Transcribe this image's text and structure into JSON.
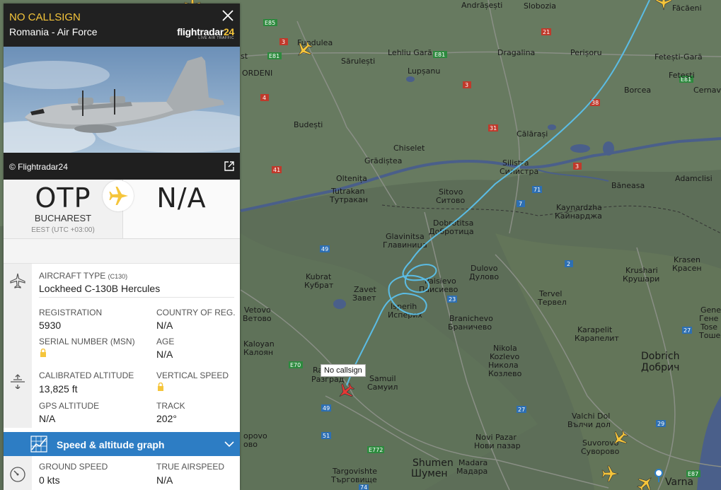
{
  "panel": {
    "callsign": "NO CALLSIGN",
    "operator": "Romania - Air Force",
    "brand_main": "flightradar",
    "brand_num": "24",
    "brand_sub": "LIVE AIR TRAFFIC",
    "photo_credit": "© Flightradar24",
    "origin": {
      "iata": "OTP",
      "city": "BUCHAREST",
      "tz": "EEST (UTC +03:00)"
    },
    "destination": {
      "iata": "N/A"
    },
    "aircraft_type_label": "AIRCRAFT TYPE",
    "aircraft_type_code": "(C130)",
    "aircraft_type_value": "Lockheed C-130B Hercules",
    "registration_label": "REGISTRATION",
    "registration_value": "5930",
    "country_label": "COUNTRY OF REG.",
    "country_value": "N/A",
    "msn_label": "SERIAL NUMBER (MSN)",
    "age_label": "AGE",
    "age_value": "N/A",
    "cal_alt_label": "CALIBRATED ALTITUDE",
    "cal_alt_value": "13,825 ft",
    "vs_label": "VERTICAL SPEED",
    "gps_alt_label": "GPS ALTITUDE",
    "gps_alt_value": "N/A",
    "track_label": "TRACK",
    "track_value": "202°",
    "graph_label": "Speed & altitude graph",
    "ground_speed_label": "GROUND SPEED",
    "ground_speed_value": "0 kts",
    "tas_label": "TRUE AIRSPEED",
    "tas_value": "N/A"
  },
  "map": {
    "tooltip": "No callsign",
    "labels": {
      "andrasesti": "Andrășești",
      "slobozia": "Slobozia",
      "facaeni": "Făcăeni",
      "fundulea": "Fundulea",
      "lehliu": "Lehliu Gară",
      "dragalina": "Dragalina",
      "perisoru": "Perișoru",
      "fetesti_gara": "Fetești-Gară",
      "sarulesti": "Sărulești",
      "lupsanu": "Lupșanu",
      "fetesti": "Fetești",
      "borcea": "Borcea",
      "cernavoda": "Cernavo",
      "budesti": "Budești",
      "calarasi": "Călărași",
      "chiselet": "Chiselet",
      "gradistea": "Grădiștea",
      "silistra": "Silistra",
      "silistra_cy": "Силистра",
      "oltenita": "Oltenița",
      "baneasa": "Băneasa",
      "adamclisi": "Adamclisi",
      "tutrakan": "Tutrakan",
      "tutrakan_cy": "Тутракан",
      "sitovo": "Sitovo",
      "sitovo_cy": "Ситово",
      "kaynardzha": "Kaynardzha",
      "kaynardzha_cy": "Кайнарджа",
      "dobrotitsa": "Dobrotitsa",
      "dobrotitsa_cy": "Добротица",
      "glavinitsa": "Glavinitsa",
      "glavinitsa_cy": "Главиница",
      "krasen": "Krasen",
      "krasen_cy": "Красен",
      "kubrat": "Kubrat",
      "kubrat_cy": "Кубрат",
      "dulovo": "Dulovo",
      "dulovo_cy": "Дулово",
      "krushari": "Krushari",
      "krushari_cy": "Крушари",
      "zavet": "Zavet",
      "zavet_cy": "Завет",
      "paisievo": "Paisievo",
      "paisievo_cy": "Паисиево",
      "tervel": "Tervel",
      "tervel_cy": "Тервел",
      "vetovo": "Vetovo",
      "vetovo_cy": "Ветово",
      "isperih": "Isperih",
      "isperih_cy": "Исперих",
      "branichevo": "Branichevo",
      "branichevo_cy": "Браничево",
      "karapelit": "Karapelit",
      "karapelit_cy": "Карапелит",
      "kaloyan": "Kaloyan",
      "kaloyan_cy": "Калоян",
      "nikola": "Nikola",
      "kozlevo": "Kozlevo",
      "nikola_cy": "Никола",
      "kozlevo_cy": "Козлево",
      "dobrich": "Dobrich",
      "dobrich_cy": "Добрич",
      "razgrad": "Ra",
      "razgrad_cy": "Разград",
      "samuil": "Samuil",
      "samuil_cy": "Самуил",
      "valchi_dol": "Valchi Dol",
      "valchi_dol_cy": "Вълчи дол",
      "suvorovo": "Suvorovo",
      "suvorovo_cy": "Суворово",
      "novi_pazar": "Novi Pazar",
      "novi_pazar_cy": "Нови пазар",
      "shumen": "Shumen",
      "shumen_cy": "Шумен",
      "madara": "Madara",
      "madara_cy": "Мадара",
      "targovishte": "Targovishte",
      "targovishte_cy": "Търговище",
      "varna": "Varna",
      "tose": "Tose",
      "tose_cy": "Тоше",
      "gene": "Gene",
      "gene_cy": "Гене",
      "popovo": "opovo",
      "popovo_cy": "ово",
      "ordeni": "ORDENI",
      "st": "st"
    },
    "roads": [
      "E85",
      "3",
      "21",
      "E81",
      "E81",
      "3",
      "38",
      "E81",
      "4",
      "31",
      "41",
      "3",
      "71",
      "7",
      "49",
      "23",
      "E70",
      "49",
      "27",
      "E772",
      "51",
      "29",
      "27",
      "E87",
      "E87",
      "E87",
      "74",
      "2",
      "7",
      "E70"
    ],
    "colors": {
      "track": "#5bbce4",
      "panel_accent": "#f5c53b",
      "graph_bar": "#2d7dc4",
      "aircraft_selected": "#e53935"
    }
  }
}
